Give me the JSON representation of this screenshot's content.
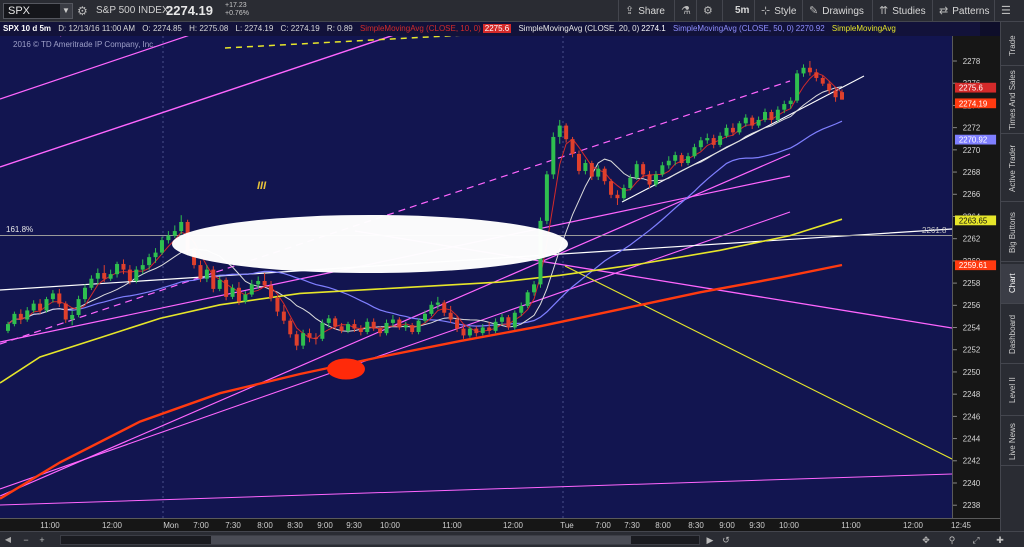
{
  "toolbar": {
    "symbol": "SPX",
    "symbol_name": "S&P 500 INDEX",
    "last_price": "2274.19",
    "change_abs": "+17.23",
    "change_pct": "+0.76%",
    "share": "Share",
    "interval": "5m",
    "style": "Style",
    "drawings": "Drawings",
    "studies": "Studies",
    "patterns": "Patterns"
  },
  "info_line": {
    "desc": "SPX 10 d 5m",
    "date": "D: 12/13/16 11:00 AM",
    "open": "O: 2274.85",
    "high": "H: 2275.08",
    "low": "L: 2274.19",
    "close": "C: 2274.19",
    "range": "R: 0.89",
    "sma10": "SimpleMovingAvg (CLOSE, 10, 0)",
    "sma10_val": "2275.6",
    "sma20": "SimpleMovingAvg (CLOSE, 20, 0)",
    "sma20_val": "2274.1",
    "sma50": "SimpleMovingAvg (CLOSE, 50, 0)",
    "sma50_val": "2270.92",
    "sma_more": "SimpleMovingAvg"
  },
  "copyright": "2016 © TD Ameritrade IP Company, Inc.",
  "annotations": {
    "fib_label": "161.8%",
    "wave_label": "III",
    "fib_price": "2261.8"
  },
  "side_tabs": [
    "Trade",
    "Times And Sales",
    "Active Trader",
    "Big Buttons",
    "Chart",
    "Dashboard",
    "Level II",
    "Live News"
  ],
  "side_tab_active": "Chart",
  "colors": {
    "background": "#121550",
    "up_candle": "#2fbf4f",
    "down_candle": "#e0402c",
    "sma10": "#d42a2a",
    "sma20": "#dcdcdc",
    "sma50": "#7f7fff",
    "sma_yellow": "#e6e62a",
    "sma_orange": "#ff3a10",
    "channel": "#ff66ff"
  },
  "chart_data": {
    "type": "candlestick",
    "y_ticks": [
      "2278",
      "2276",
      "2274",
      "2272",
      "2270",
      "2268",
      "2266",
      "2264",
      "2262",
      "2260",
      "2258",
      "2256",
      "2254",
      "2252",
      "2250",
      "2248",
      "2246",
      "2244",
      "2242",
      "2240",
      "2238"
    ],
    "ylim": [
      2237.3,
      2279.8
    ],
    "x_ticks": [
      "11:00",
      "12:00",
      "Mon",
      "7:00",
      "7:30",
      "8:00",
      "8:30",
      "9:00",
      "9:30",
      "10:00",
      "11:00",
      "12:00",
      "Tue",
      "7:00",
      "7:30",
      "8:00",
      "8:30",
      "9:00",
      "9:30",
      "10:00",
      "11:00",
      "12:00",
      "12:45"
    ],
    "price_labels": [
      {
        "value": 2275.6,
        "text": "2275.6",
        "color": "#d42a2a"
      },
      {
        "value": 2274.19,
        "text": "2274.19",
        "color": "#ff3a10"
      },
      {
        "value": 2270.92,
        "text": "2270.92",
        "color": "#7f7fff"
      },
      {
        "value": 2263.65,
        "text": "2263.65",
        "color": "#e6e62a"
      },
      {
        "value": 2259.61,
        "text": "2259.61",
        "color": "#ff3a10"
      }
    ],
    "candles": [
      [
        2253.8,
        2254.6,
        2253.6,
        2254.4
      ],
      [
        2254.4,
        2255.5,
        2254.2,
        2255.3
      ],
      [
        2255.3,
        2255.7,
        2254.4,
        2254.8
      ],
      [
        2254.8,
        2255.9,
        2254.6,
        2255.6
      ],
      [
        2255.6,
        2256.5,
        2255.4,
        2256.2
      ],
      [
        2256.2,
        2256.6,
        2255.3,
        2255.6
      ],
      [
        2255.6,
        2256.8,
        2255.4,
        2256.6
      ],
      [
        2256.6,
        2257.4,
        2256.3,
        2257.1
      ],
      [
        2257.1,
        2257.5,
        2255.9,
        2256.2
      ],
      [
        2256.2,
        2256.4,
        2254.5,
        2254.8
      ],
      [
        2254.8,
        2255.6,
        2254.3,
        2255.2
      ],
      [
        2255.2,
        2256.9,
        2255,
        2256.6
      ],
      [
        2256.6,
        2257.9,
        2256.3,
        2257.6
      ],
      [
        2257.6,
        2258.7,
        2257.4,
        2258.4
      ],
      [
        2258.4,
        2259.3,
        2257.9,
        2258.9
      ],
      [
        2258.9,
        2259.6,
        2258.1,
        2258.4
      ],
      [
        2258.4,
        2259.2,
        2258.2,
        2258.8
      ],
      [
        2258.8,
        2259.9,
        2258.5,
        2259.7
      ],
      [
        2259.7,
        2260.1,
        2258.8,
        2259.2
      ],
      [
        2259.2,
        2259.6,
        2257.9,
        2258.2
      ],
      [
        2258.2,
        2259.5,
        2258,
        2259.2
      ],
      [
        2259.2,
        2260.1,
        2258.8,
        2259.6
      ],
      [
        2259.6,
        2260.6,
        2259.2,
        2260.3
      ],
      [
        2260.3,
        2261.1,
        2259.8,
        2260.7
      ],
      [
        2260.7,
        2262.1,
        2260.5,
        2261.8
      ],
      [
        2261.8,
        2262.6,
        2261.5,
        2262.2
      ],
      [
        2262.2,
        2263.1,
        2262,
        2262.6
      ],
      [
        2262.6,
        2264,
        2262.3,
        2263.4
      ],
      [
        2263.4,
        2263.6,
        2260.5,
        2260.9
      ],
      [
        2260.9,
        2261.2,
        2259.3,
        2259.6
      ],
      [
        2259.6,
        2260,
        2258.1,
        2258.4
      ],
      [
        2258.4,
        2259.6,
        2258.1,
        2259.2
      ],
      [
        2259.2,
        2259.5,
        2257.2,
        2257.5
      ],
      [
        2257.5,
        2258.6,
        2257.3,
        2258.3
      ],
      [
        2258.3,
        2258.5,
        2256.5,
        2256.8
      ],
      [
        2256.8,
        2257.9,
        2256.6,
        2257.6
      ],
      [
        2257.6,
        2258.1,
        2256.1,
        2256.4
      ],
      [
        2256.4,
        2257.3,
        2256.2,
        2257
      ],
      [
        2257,
        2258.3,
        2256.8,
        2257.9
      ],
      [
        2257.9,
        2258.6,
        2257.5,
        2258.2
      ],
      [
        2258.2,
        2258.9,
        2257.6,
        2257.8
      ],
      [
        2257.8,
        2258.2,
        2256.4,
        2256.7
      ],
      [
        2256.7,
        2256.9,
        2255.1,
        2255.5
      ],
      [
        2255.5,
        2256.1,
        2254.4,
        2254.7
      ],
      [
        2254.7,
        2254.9,
        2253.2,
        2253.5
      ],
      [
        2253.5,
        2253.8,
        2252.1,
        2252.5
      ],
      [
        2252.5,
        2253.9,
        2252.2,
        2253.6
      ],
      [
        2253.6,
        2254,
        2252.8,
        2253.2
      ],
      [
        2253.2,
        2253.6,
        2252.6,
        2253.1
      ],
      [
        2253.1,
        2254.8,
        2252.9,
        2254.5
      ],
      [
        2254.5,
        2255.2,
        2254.1,
        2254.9
      ],
      [
        2254.9,
        2255.1,
        2253.9,
        2254.2
      ],
      [
        2254.2,
        2254.5,
        2253.6,
        2253.8
      ],
      [
        2253.8,
        2254.6,
        2253.6,
        2254.4
      ],
      [
        2254.4,
        2254.8,
        2253.7,
        2254
      ],
      [
        2254,
        2254.3,
        2253.4,
        2253.7
      ],
      [
        2253.7,
        2254.9,
        2253.5,
        2254.6
      ],
      [
        2254.6,
        2254.9,
        2253.8,
        2254
      ],
      [
        2254,
        2254.2,
        2253.3,
        2253.6
      ],
      [
        2253.6,
        2254.8,
        2253.4,
        2254.5
      ],
      [
        2254.5,
        2255.2,
        2254.2,
        2254.8
      ],
      [
        2254.8,
        2255,
        2253.9,
        2254.1
      ],
      [
        2254.1,
        2254.6,
        2253.8,
        2254.3
      ],
      [
        2254.3,
        2254.5,
        2253.5,
        2253.7
      ],
      [
        2253.7,
        2254.9,
        2253.5,
        2254.7
      ],
      [
        2254.7,
        2255.6,
        2254.5,
        2255.3
      ],
      [
        2255.3,
        2256.4,
        2255.1,
        2256.1
      ],
      [
        2256.1,
        2256.8,
        2255.7,
        2256.3
      ],
      [
        2256.3,
        2256.5,
        2255.1,
        2255.4
      ],
      [
        2255.4,
        2256,
        2254.5,
        2254.8
      ],
      [
        2254.8,
        2255.1,
        2253.7,
        2254
      ],
      [
        2254,
        2254.3,
        2253.1,
        2253.4
      ],
      [
        2253.4,
        2254.2,
        2253.2,
        2254
      ],
      [
        2254,
        2254.2,
        2253.3,
        2253.6
      ],
      [
        2253.6,
        2254.4,
        2253.4,
        2254.1
      ],
      [
        2254.1,
        2254.6,
        2253.5,
        2253.8
      ],
      [
        2253.8,
        2254.9,
        2253.6,
        2254.6
      ],
      [
        2254.6,
        2255.3,
        2254.3,
        2255
      ],
      [
        2255,
        2255.2,
        2253.9,
        2254.1
      ],
      [
        2254.1,
        2255.6,
        2253.9,
        2255.4
      ],
      [
        2255.4,
        2256.3,
        2255.1,
        2256
      ],
      [
        2256,
        2257.4,
        2255.8,
        2257.2
      ],
      [
        2257.2,
        2258.2,
        2256.9,
        2257.9
      ],
      [
        2257.9,
        2263.8,
        2257.6,
        2263.5
      ],
      [
        2263.5,
        2267.9,
        2263.2,
        2267.6
      ],
      [
        2267.6,
        2271.3,
        2267.2,
        2270.9
      ],
      [
        2270.9,
        2272.4,
        2270.3,
        2271.9
      ],
      [
        2271.9,
        2272.1,
        2270.4,
        2270.7
      ],
      [
        2270.7,
        2270.9,
        2269.1,
        2269.4
      ],
      [
        2269.4,
        2269.7,
        2267.6,
        2267.9
      ],
      [
        2267.9,
        2268.9,
        2267.6,
        2268.6
      ],
      [
        2268.6,
        2268.8,
        2267.1,
        2267.4
      ],
      [
        2267.4,
        2268.4,
        2267.1,
        2268.1
      ],
      [
        2268.1,
        2268.3,
        2266.7,
        2267
      ],
      [
        2267,
        2267.2,
        2265.5,
        2265.8
      ],
      [
        2265.8,
        2266.2,
        2264.9,
        2265.5
      ],
      [
        2265.5,
        2266.7,
        2265.3,
        2266.4
      ],
      [
        2266.4,
        2267.6,
        2266.2,
        2267.3
      ],
      [
        2267.3,
        2268.8,
        2267.1,
        2268.5
      ],
      [
        2268.5,
        2268.7,
        2267.3,
        2267.6
      ],
      [
        2267.6,
        2267.9,
        2266.4,
        2266.7
      ],
      [
        2266.7,
        2267.9,
        2266.5,
        2267.6
      ],
      [
        2267.6,
        2268.7,
        2267.4,
        2268.4
      ],
      [
        2268.4,
        2269.2,
        2268.1,
        2268.8
      ],
      [
        2268.8,
        2269.6,
        2268.4,
        2269.3
      ],
      [
        2269.3,
        2269.5,
        2268.3,
        2268.6
      ],
      [
        2268.6,
        2269.5,
        2268.4,
        2269.2
      ],
      [
        2269.2,
        2270.3,
        2269,
        2270
      ],
      [
        2270,
        2270.9,
        2269.7,
        2270.6
      ],
      [
        2270.6,
        2271.2,
        2270.3,
        2270.8
      ],
      [
        2270.8,
        2271.1,
        2269.9,
        2270.2
      ],
      [
        2270.2,
        2271.3,
        2270,
        2271
      ],
      [
        2271,
        2272,
        2270.8,
        2271.7
      ],
      [
        2271.7,
        2272.1,
        2271,
        2271.3
      ],
      [
        2271.3,
        2272.3,
        2271.1,
        2272.1
      ],
      [
        2272.1,
        2272.9,
        2271.8,
        2272.6
      ],
      [
        2272.6,
        2272.8,
        2271.6,
        2271.9
      ],
      [
        2271.9,
        2272.7,
        2271.7,
        2272.4
      ],
      [
        2272.4,
        2273.4,
        2272.2,
        2273.1
      ],
      [
        2273.1,
        2273.3,
        2272.1,
        2272.4
      ],
      [
        2272.4,
        2273.6,
        2272.2,
        2273.3
      ],
      [
        2273.3,
        2274.1,
        2273,
        2273.8
      ],
      [
        2273.8,
        2274.4,
        2273.4,
        2274.1
      ],
      [
        2274.1,
        2276.8,
        2273.9,
        2276.5
      ],
      [
        2276.5,
        2277.3,
        2276.2,
        2277
      ],
      [
        2277,
        2277.6,
        2276.3,
        2276.6
      ],
      [
        2276.6,
        2276.9,
        2275.8,
        2276.1
      ],
      [
        2276.1,
        2276.3,
        2275.4,
        2275.6
      ],
      [
        2275.6,
        2275.8,
        2274.7,
        2275
      ],
      [
        2275,
        2275.2,
        2274,
        2274.4
      ],
      [
        2274.85,
        2275.08,
        2274.19,
        2274.19
      ]
    ],
    "sma10_series": "red moving average",
    "sma20_series": "white moving average",
    "sma50_series": "blue moving average"
  }
}
